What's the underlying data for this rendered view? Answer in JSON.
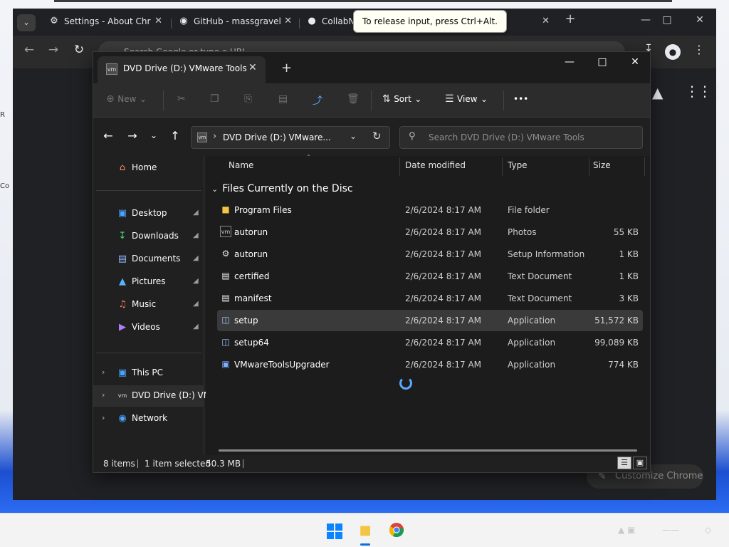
{
  "chrome": {
    "tabs": [
      {
        "label": "Settings - About Chr",
        "icon": "gear-icon"
      },
      {
        "label": "GitHub - massgravel",
        "icon": "github-icon"
      },
      {
        "label": "CollabN",
        "icon": "globe-icon"
      }
    ],
    "new_tab": "+",
    "omnibox_placeholder": "Search Google or type a URL",
    "customize_label": "Customize Chrome"
  },
  "tooltip": {
    "text": "To release input, press Ctrl+Alt."
  },
  "explorer": {
    "tab_title": "DVD Drive (D:) VMware Tools",
    "commands": {
      "new": "New",
      "sort": "Sort",
      "view": "View",
      "more": "•••"
    },
    "address": "DVD Drive (D:) VMware...",
    "search_placeholder": "Search DVD Drive (D:) VMware Tools",
    "nav": {
      "home": "Home",
      "quick_access": [
        {
          "label": "Desktop",
          "icon": "desktop-icon"
        },
        {
          "label": "Downloads",
          "icon": "downloads-icon"
        },
        {
          "label": "Documents",
          "icon": "documents-icon"
        },
        {
          "label": "Pictures",
          "icon": "pictures-icon"
        },
        {
          "label": "Music",
          "icon": "music-icon"
        },
        {
          "label": "Videos",
          "icon": "videos-icon"
        }
      ],
      "this_pc": "This PC",
      "dvd_drive": "DVD Drive (D:) VMw",
      "network": "Network"
    },
    "columns": {
      "name": "Name",
      "date": "Date modified",
      "type": "Type",
      "size": "Size"
    },
    "group_label": "Files Currently on the Disc",
    "files": [
      {
        "name": "Program Files",
        "date": "2/6/2024 8:17 AM",
        "type": "File folder",
        "size": "",
        "icon": "folder-icon"
      },
      {
        "name": "autorun",
        "date": "2/6/2024 8:17 AM",
        "type": "Photos",
        "size": "55 KB",
        "icon": "vm-logo-icon"
      },
      {
        "name": "autorun",
        "date": "2/6/2024 8:17 AM",
        "type": "Setup Information",
        "size": "1 KB",
        "icon": "setup-info-icon"
      },
      {
        "name": "certified",
        "date": "2/6/2024 8:17 AM",
        "type": "Text Document",
        "size": "1 KB",
        "icon": "text-file-icon"
      },
      {
        "name": "manifest",
        "date": "2/6/2024 8:17 AM",
        "type": "Text Document",
        "size": "3 KB",
        "icon": "text-file-icon"
      },
      {
        "name": "setup",
        "date": "2/6/2024 8:17 AM",
        "type": "Application",
        "size": "51,572 KB",
        "icon": "installer-icon"
      },
      {
        "name": "setup64",
        "date": "2/6/2024 8:17 AM",
        "type": "Application",
        "size": "99,089 KB",
        "icon": "installer-icon"
      },
      {
        "name": "VMwareToolsUpgrader",
        "date": "2/6/2024 8:17 AM",
        "type": "Application",
        "size": "774 KB",
        "icon": "app-icon"
      }
    ],
    "status": {
      "items": "8 items",
      "selected": "1 item selected",
      "size": "50.3 MB"
    }
  }
}
